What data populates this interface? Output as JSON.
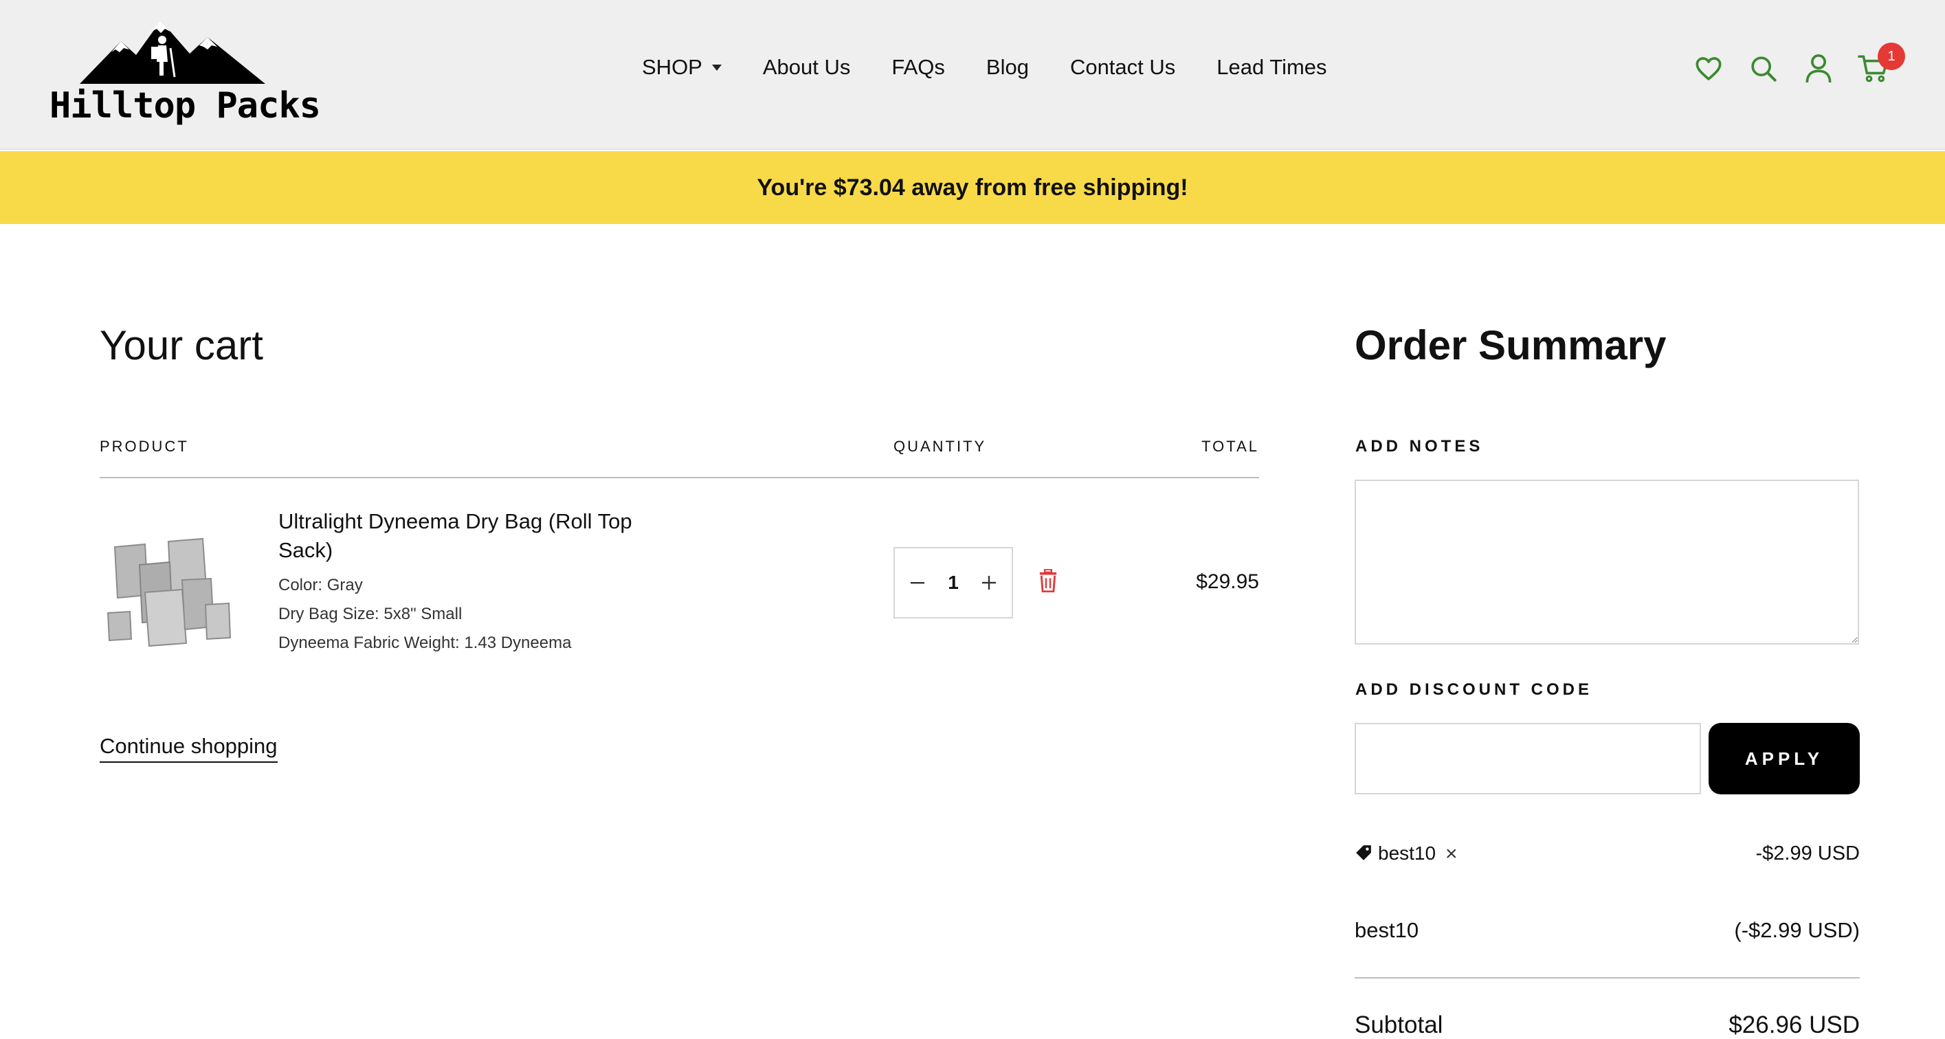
{
  "header": {
    "logo_text": "Hilltop Packs",
    "nav": [
      {
        "label": "SHOP"
      },
      {
        "label": "About Us"
      },
      {
        "label": "FAQs"
      },
      {
        "label": "Blog"
      },
      {
        "label": "Contact Us"
      },
      {
        "label": "Lead Times"
      }
    ],
    "icons": [
      "heart-icon",
      "search-icon",
      "user-icon",
      "cart-icon"
    ],
    "cart_count": "1",
    "icon_color": "#3a8a2f",
    "badge_color": "#e53935"
  },
  "shipping_bar": {
    "message": "You're $73.04 away from free shipping!",
    "color": "#f8da48"
  },
  "cart": {
    "title": "Your cart",
    "columns": {
      "product": "PRODUCT",
      "quantity": "QUANTITY",
      "total": "TOTAL"
    },
    "items": [
      {
        "name": "Ultralight Dyneema Dry Bag (Roll Top Sack)",
        "attributes": [
          "Color: Gray",
          "Dry Bag Size: 5x8\" Small",
          "Dyneema Fabric Weight: 1.43 Dyneema"
        ],
        "quantity": "1",
        "total": "$29.95"
      }
    ],
    "continue_label": "Continue shopping"
  },
  "summary": {
    "title": "Order Summary",
    "notes_label": "ADD NOTES",
    "notes_value": "",
    "discount_label": "ADD DISCOUNT CODE",
    "discount_value": "",
    "apply_label": "APPLY",
    "applied_code": "best10",
    "applied_amount": "-$2.99 USD",
    "discount_line_label": "best10",
    "discount_line_amount": "(-$2.99 USD)",
    "subtotal_label": "Subtotal",
    "subtotal_value": "$26.96 USD"
  }
}
